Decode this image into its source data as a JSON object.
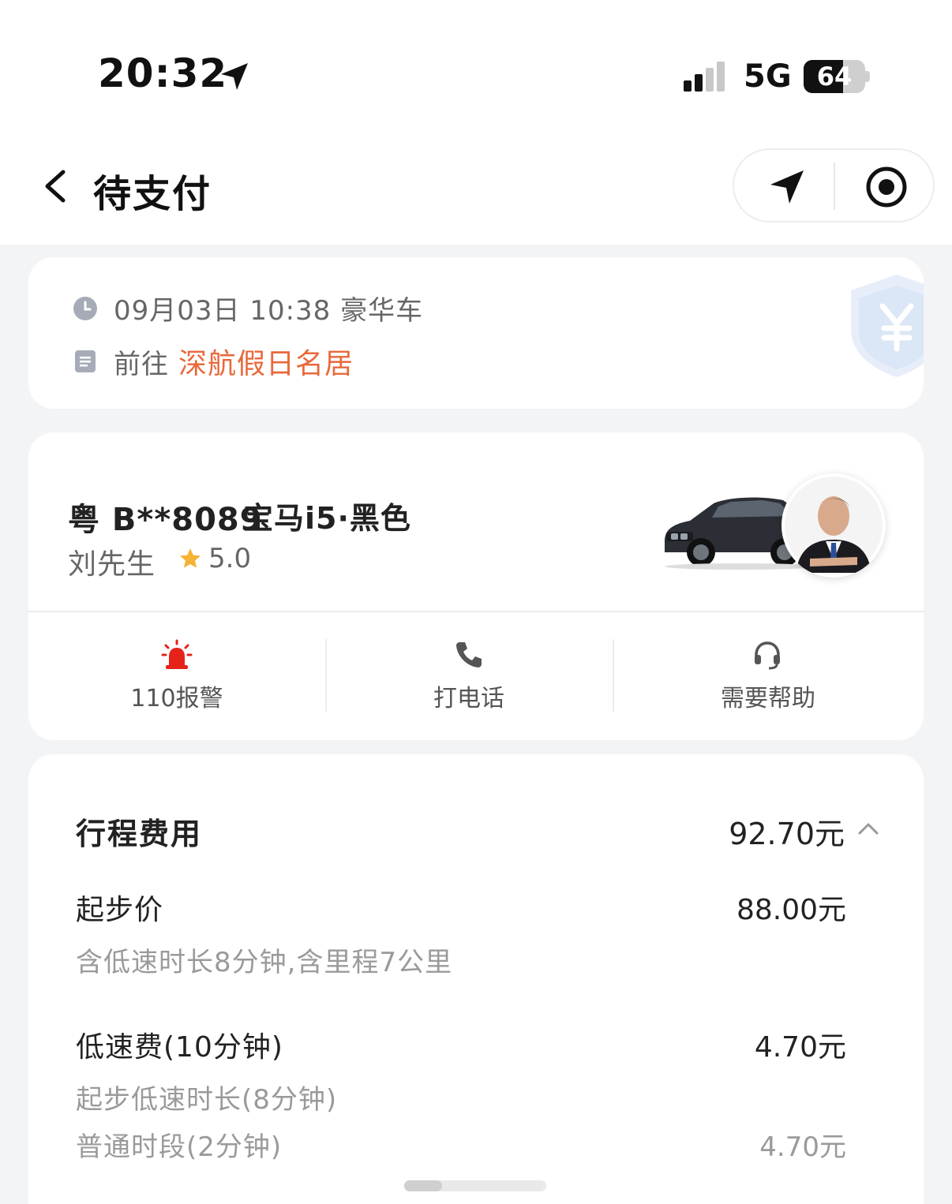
{
  "status_bar": {
    "time": "20:32",
    "network": "5G",
    "battery": "64",
    "battery_level": 0.64
  },
  "nav": {
    "title": "待支付",
    "icons": [
      "back-chevron-icon",
      "navigation-arrow-icon",
      "record-target-icon"
    ]
  },
  "trip": {
    "datetime": "09月03日 10:38 豪华车",
    "destination_prefix": "前往",
    "destination": "深航假日名居",
    "icons": [
      "clock-icon",
      "document-icon",
      "shield-yuan-icon"
    ]
  },
  "vehicle": {
    "plate": "粤 B**8089",
    "model": "宝马i5·黑色",
    "driver": "刘先生",
    "rating": "5.0"
  },
  "actions": [
    {
      "label": "110报警",
      "icon": "siren-icon"
    },
    {
      "label": "打电话",
      "icon": "phone-icon"
    },
    {
      "label": "需要帮助",
      "icon": "headset-icon"
    }
  ],
  "fees": {
    "title": "行程费用",
    "total": "92.70元",
    "items": [
      {
        "label": "起步价",
        "amount": "88.00元",
        "sub": "含低速时长8分钟,含里程7公里"
      },
      {
        "label": "低速费(10分钟)",
        "amount": "4.70元",
        "breakdown": [
          {
            "label": "起步低速时长(8分钟)",
            "amount": ""
          },
          {
            "label": "普通时段(2分钟)",
            "amount": "4.70元"
          }
        ]
      }
    ]
  },
  "colors": {
    "accent": "#e8693a",
    "alarm": "#e5231b",
    "star": "#f5b335",
    "background": "#f3f4f6"
  }
}
